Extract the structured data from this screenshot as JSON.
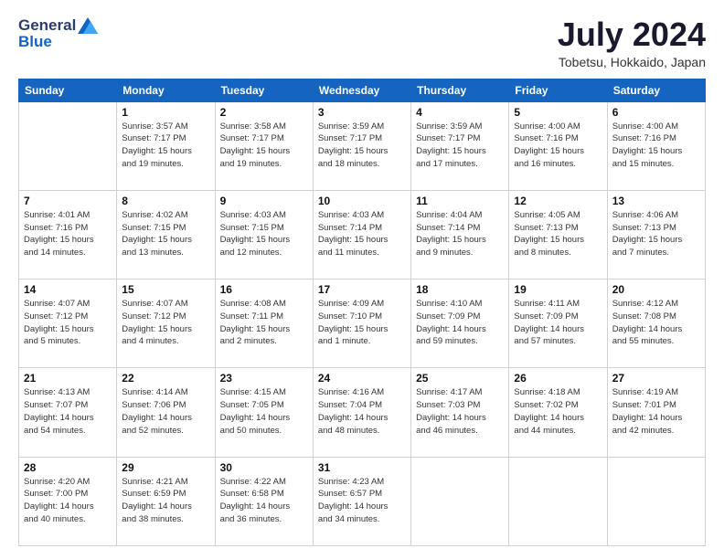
{
  "header": {
    "logo_general": "General",
    "logo_blue": "Blue",
    "month_title": "July 2024",
    "location": "Tobetsu, Hokkaido, Japan"
  },
  "calendar": {
    "headers": [
      "Sunday",
      "Monday",
      "Tuesday",
      "Wednesday",
      "Thursday",
      "Friday",
      "Saturday"
    ],
    "weeks": [
      [
        {
          "day": "",
          "info": ""
        },
        {
          "day": "1",
          "info": "Sunrise: 3:57 AM\nSunset: 7:17 PM\nDaylight: 15 hours\nand 19 minutes."
        },
        {
          "day": "2",
          "info": "Sunrise: 3:58 AM\nSunset: 7:17 PM\nDaylight: 15 hours\nand 19 minutes."
        },
        {
          "day": "3",
          "info": "Sunrise: 3:59 AM\nSunset: 7:17 PM\nDaylight: 15 hours\nand 18 minutes."
        },
        {
          "day": "4",
          "info": "Sunrise: 3:59 AM\nSunset: 7:17 PM\nDaylight: 15 hours\nand 17 minutes."
        },
        {
          "day": "5",
          "info": "Sunrise: 4:00 AM\nSunset: 7:16 PM\nDaylight: 15 hours\nand 16 minutes."
        },
        {
          "day": "6",
          "info": "Sunrise: 4:00 AM\nSunset: 7:16 PM\nDaylight: 15 hours\nand 15 minutes."
        }
      ],
      [
        {
          "day": "7",
          "info": "Sunrise: 4:01 AM\nSunset: 7:16 PM\nDaylight: 15 hours\nand 14 minutes."
        },
        {
          "day": "8",
          "info": "Sunrise: 4:02 AM\nSunset: 7:15 PM\nDaylight: 15 hours\nand 13 minutes."
        },
        {
          "day": "9",
          "info": "Sunrise: 4:03 AM\nSunset: 7:15 PM\nDaylight: 15 hours\nand 12 minutes."
        },
        {
          "day": "10",
          "info": "Sunrise: 4:03 AM\nSunset: 7:14 PM\nDaylight: 15 hours\nand 11 minutes."
        },
        {
          "day": "11",
          "info": "Sunrise: 4:04 AM\nSunset: 7:14 PM\nDaylight: 15 hours\nand 9 minutes."
        },
        {
          "day": "12",
          "info": "Sunrise: 4:05 AM\nSunset: 7:13 PM\nDaylight: 15 hours\nand 8 minutes."
        },
        {
          "day": "13",
          "info": "Sunrise: 4:06 AM\nSunset: 7:13 PM\nDaylight: 15 hours\nand 7 minutes."
        }
      ],
      [
        {
          "day": "14",
          "info": "Sunrise: 4:07 AM\nSunset: 7:12 PM\nDaylight: 15 hours\nand 5 minutes."
        },
        {
          "day": "15",
          "info": "Sunrise: 4:07 AM\nSunset: 7:12 PM\nDaylight: 15 hours\nand 4 minutes."
        },
        {
          "day": "16",
          "info": "Sunrise: 4:08 AM\nSunset: 7:11 PM\nDaylight: 15 hours\nand 2 minutes."
        },
        {
          "day": "17",
          "info": "Sunrise: 4:09 AM\nSunset: 7:10 PM\nDaylight: 15 hours\nand 1 minute."
        },
        {
          "day": "18",
          "info": "Sunrise: 4:10 AM\nSunset: 7:09 PM\nDaylight: 14 hours\nand 59 minutes."
        },
        {
          "day": "19",
          "info": "Sunrise: 4:11 AM\nSunset: 7:09 PM\nDaylight: 14 hours\nand 57 minutes."
        },
        {
          "day": "20",
          "info": "Sunrise: 4:12 AM\nSunset: 7:08 PM\nDaylight: 14 hours\nand 55 minutes."
        }
      ],
      [
        {
          "day": "21",
          "info": "Sunrise: 4:13 AM\nSunset: 7:07 PM\nDaylight: 14 hours\nand 54 minutes."
        },
        {
          "day": "22",
          "info": "Sunrise: 4:14 AM\nSunset: 7:06 PM\nDaylight: 14 hours\nand 52 minutes."
        },
        {
          "day": "23",
          "info": "Sunrise: 4:15 AM\nSunset: 7:05 PM\nDaylight: 14 hours\nand 50 minutes."
        },
        {
          "day": "24",
          "info": "Sunrise: 4:16 AM\nSunset: 7:04 PM\nDaylight: 14 hours\nand 48 minutes."
        },
        {
          "day": "25",
          "info": "Sunrise: 4:17 AM\nSunset: 7:03 PM\nDaylight: 14 hours\nand 46 minutes."
        },
        {
          "day": "26",
          "info": "Sunrise: 4:18 AM\nSunset: 7:02 PM\nDaylight: 14 hours\nand 44 minutes."
        },
        {
          "day": "27",
          "info": "Sunrise: 4:19 AM\nSunset: 7:01 PM\nDaylight: 14 hours\nand 42 minutes."
        }
      ],
      [
        {
          "day": "28",
          "info": "Sunrise: 4:20 AM\nSunset: 7:00 PM\nDaylight: 14 hours\nand 40 minutes."
        },
        {
          "day": "29",
          "info": "Sunrise: 4:21 AM\nSunset: 6:59 PM\nDaylight: 14 hours\nand 38 minutes."
        },
        {
          "day": "30",
          "info": "Sunrise: 4:22 AM\nSunset: 6:58 PM\nDaylight: 14 hours\nand 36 minutes."
        },
        {
          "day": "31",
          "info": "Sunrise: 4:23 AM\nSunset: 6:57 PM\nDaylight: 14 hours\nand 34 minutes."
        },
        {
          "day": "",
          "info": ""
        },
        {
          "day": "",
          "info": ""
        },
        {
          "day": "",
          "info": ""
        }
      ]
    ]
  }
}
